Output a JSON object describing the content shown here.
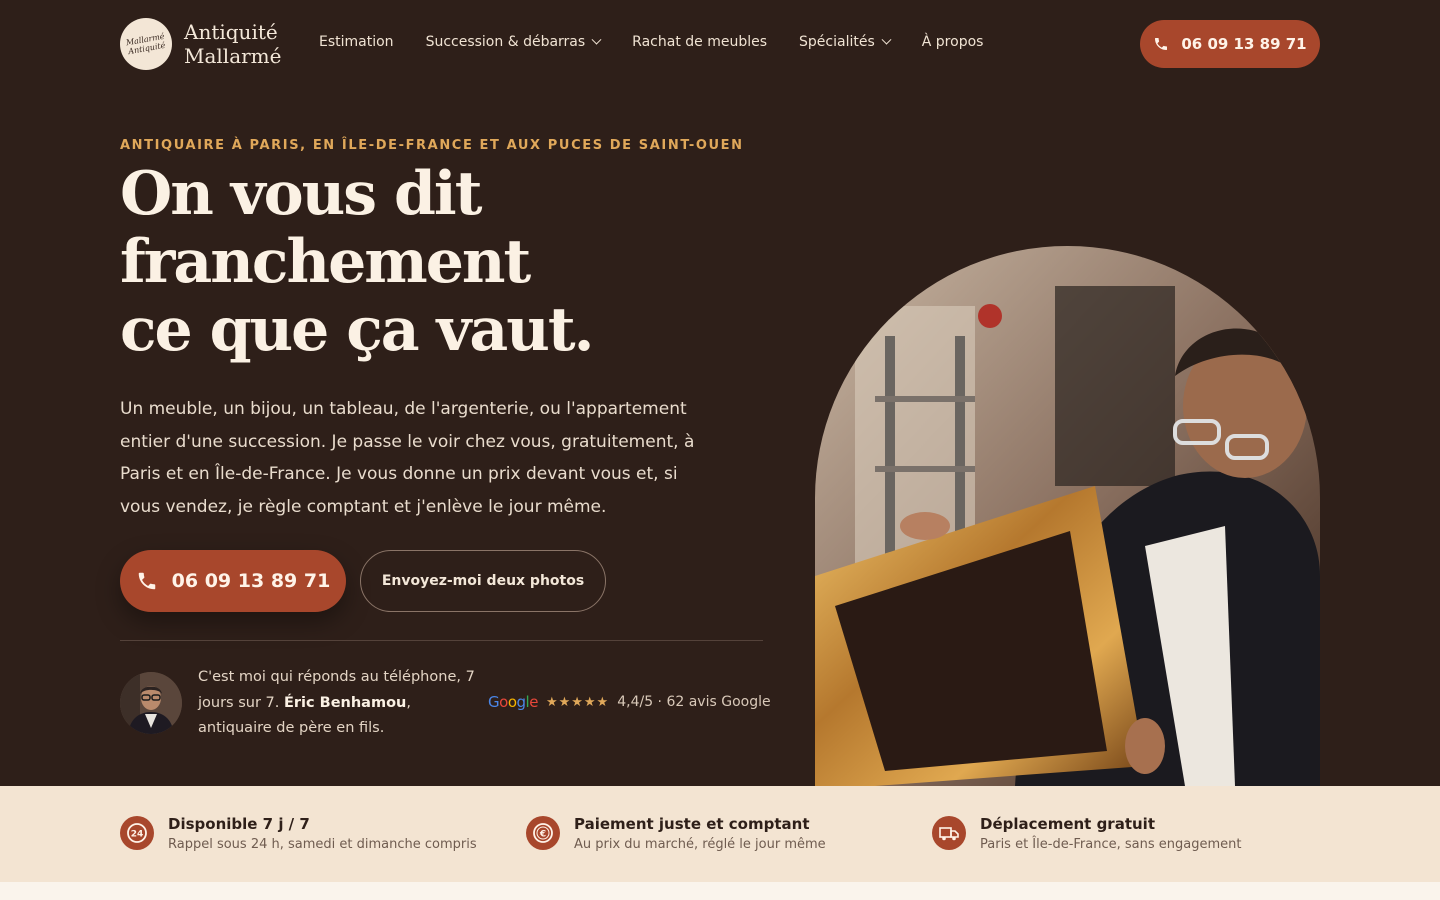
{
  "nav": {
    "logo_badge": "Mallarmé Antiquité",
    "logo_line1": "Antiquité",
    "logo_line2": "Mallarmé",
    "items": [
      {
        "label": "Estimation",
        "dropdown": false
      },
      {
        "label": "Succession & débarras",
        "dropdown": true
      },
      {
        "label": "Rachat de meubles",
        "dropdown": false
      },
      {
        "label": "Spécialités",
        "dropdown": true
      },
      {
        "label": "À propos",
        "dropdown": false
      }
    ],
    "cta_phone": "06 09 13 89 71"
  },
  "hero": {
    "eyebrow": "ANTIQUAIRE À PARIS, EN ÎLE-DE-FRANCE ET AUX PUCES DE SAINT-OUEN",
    "headline_lines": [
      "On vous dit",
      "franchement",
      "ce que ça vaut."
    ],
    "lead": "Un meuble, un bijou, un tableau, de l'argenterie, ou l'appartement entier d'une succession. Je passe le voir chez vous, gratuitement, à Paris et en Île-de-France. Je vous donne un prix devant vous et, si vous vendez, je règle comptant et j'enlève le jour même.",
    "primary_cta": "06 09 13 89 71",
    "secondary_cta": "Envoyez-moi deux photos",
    "quote_part1": "C'est moi qui réponds au téléphone, 7 jours sur 7. ",
    "quote_name": "Éric Benhamou",
    "quote_part2": ", antiquaire de père en fils.",
    "rating_stars": "★★★★★",
    "rating_text": "4,4/5 · 62 avis Google",
    "google_letters": [
      "G",
      "o",
      "o",
      "g",
      "l",
      "e"
    ]
  },
  "features": [
    {
      "title": "Disponible 7 j / 7",
      "subtitle": "Rappel sous 24 h, samedi et dimanche compris",
      "icon": "clock-24-icon"
    },
    {
      "title": "Paiement juste et comptant",
      "subtitle": "Au prix du marché, réglé le jour même",
      "icon": "euro-coin-icon"
    },
    {
      "title": "Déplacement gratuit",
      "subtitle": "Paris et Île-de-France, sans engagement",
      "icon": "delivery-truck-icon"
    }
  ],
  "colors": {
    "background": "#2e1f19",
    "accent": "#a8472c",
    "eyebrow": "#e0a85a",
    "band": "#f3e4d2"
  }
}
